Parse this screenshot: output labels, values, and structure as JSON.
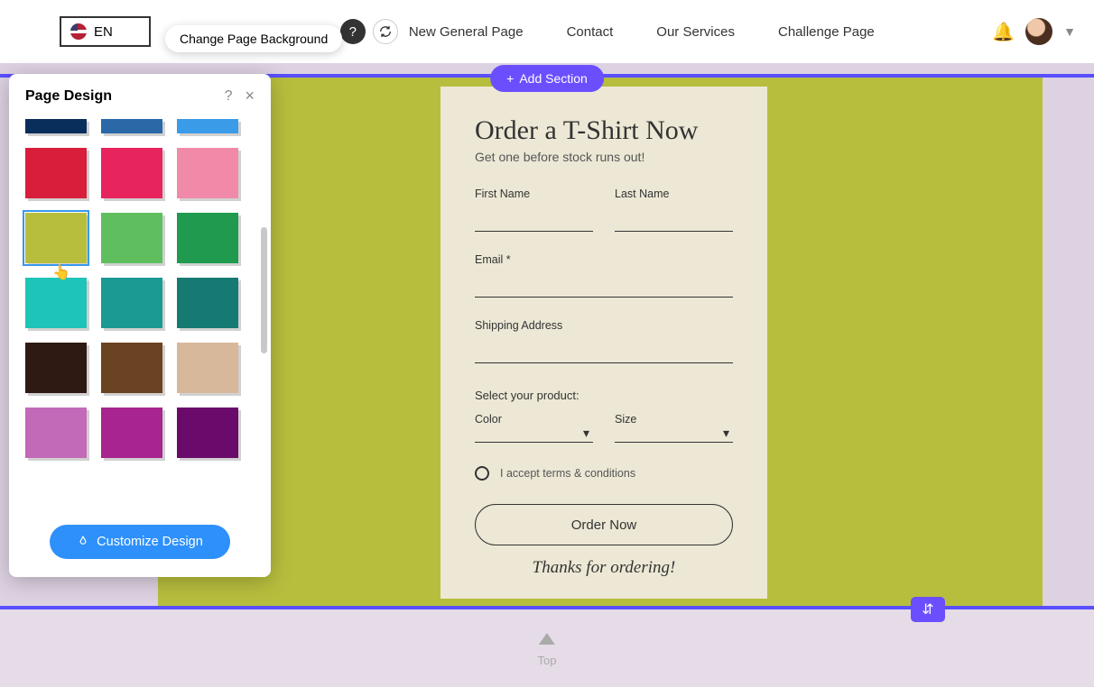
{
  "header": {
    "lang": "EN",
    "tooltip": "Change Page Background",
    "nav": [
      "New General Page",
      "Contact",
      "Our Services",
      "Challenge Page"
    ]
  },
  "editor": {
    "add_section": "Add Section",
    "top_label": "Top"
  },
  "form": {
    "title": "Order a T-Shirt Now",
    "subtitle": "Get one before stock runs out!",
    "first_name": "First Name",
    "last_name": "Last Name",
    "email": "Email *",
    "address": "Shipping Address",
    "select_product": "Select your product:",
    "color": "Color",
    "size": "Size",
    "terms": "I accept terms & conditions",
    "order_btn": "Order Now",
    "thanks": "Thanks for ordering!"
  },
  "panel": {
    "title": "Page Design",
    "customize": "Customize Design",
    "colors": [
      "#0a2e5c",
      "#2a68a8",
      "#3a9be8",
      "#d81e3a",
      "#e8245e",
      "#f08aa8",
      "#b7be3e",
      "#5fbf5f",
      "#1f9a4f",
      "#1fc4b8",
      "#1a9a92",
      "#147a72",
      "#2e1a12",
      "#6a4322",
      "#d8b89a",
      "#c26ab8",
      "#a8248e",
      "#6a0a6a"
    ],
    "selected_color_index": 6
  }
}
